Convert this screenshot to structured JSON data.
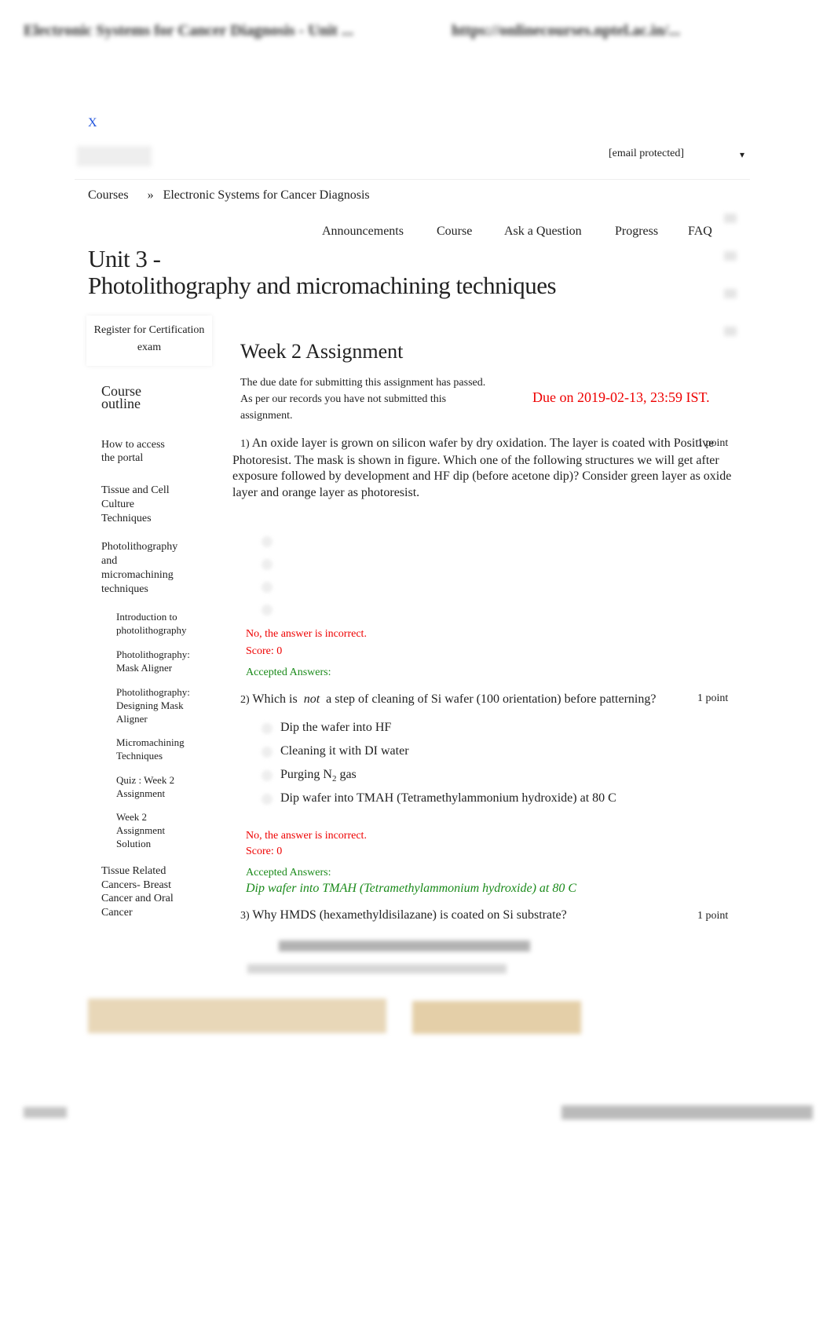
{
  "browser": {
    "title": "Electronic Systems for Cancer Diagnosis - Unit ...",
    "url": "https://onlinecourses.nptel.ac.in/..."
  },
  "close_label": "X",
  "user": {
    "email": "[email protected]",
    "dropdown": "▾"
  },
  "breadcrumb": {
    "root": "Courses",
    "sep": "»",
    "course": "Electronic Systems for Cancer Diagnosis"
  },
  "nav": [
    "Announcements",
    "Course",
    "Ask a Question",
    "Progress",
    "FAQ"
  ],
  "unit_title": {
    "line1": "Unit 3 -",
    "line2": "Photolithography and micromachining techniques"
  },
  "sidebar": {
    "register": "Register for Certification exam",
    "outline": "Course outline",
    "items": [
      "How to access the portal",
      "Tissue and Cell Culture Techniques",
      "Photolithography and micromachining techniques"
    ],
    "subitems": [
      "Introduction to photolithography",
      "Photolithography: Mask Aligner",
      "Photolithography: Designing Mask Aligner",
      "Micromachining Techniques",
      "Quiz : Week 2 Assignment",
      "Week 2 Assignment Solution"
    ],
    "last": "Tissue Related Cancers- Breast Cancer and Oral Cancer"
  },
  "assignment": {
    "title": "Week 2 Assignment",
    "notice1": "The due date for submitting this assignment has passed.",
    "notice2": "As per our records you have not submitted this assignment.",
    "due": "Due on 2019-02-13, 23:59 IST."
  },
  "questions": [
    {
      "num": "1)",
      "text": "An oxide layer is grown on silicon wafer by dry oxidation. The layer is coated with Positive Photoresist. The mask is shown in figure. Which one of the following structures we will get after exposure followed by development and HF dip (before acetone dip)? Consider green layer as oxide layer and orange layer as photoresist.",
      "points": "1 point",
      "feedback": "No, the answer is incorrect.",
      "score": "Score: 0",
      "accepted_label": "Accepted Answers:"
    },
    {
      "num": "2)",
      "text_pre": "Which is ",
      "text_em": "not",
      "text_post": " a step of cleaning of Si wafer (100 orientation) before patterning?",
      "points": "1 point",
      "options": [
        "Dip the wafer into HF",
        "Cleaning it with DI water",
        "Purging N",
        "Dip wafer into TMAH (Tetramethylammonium hydroxide) at 80 C"
      ],
      "option3_sub": "2",
      "option3_post": " gas",
      "feedback": "No, the answer is incorrect.",
      "score": "Score: 0",
      "accepted_label": "Accepted Answers:",
      "accepted": "Dip wafer into TMAH (Tetramethylammonium hydroxide) at 80 C"
    },
    {
      "num": "3)",
      "text": "Why HMDS (hexamethyldisilazane) is coated on Si substrate?",
      "points": "1 point"
    }
  ],
  "colors": {
    "link": "#2255dd",
    "error": "#ee0000",
    "success": "#1a8a1a",
    "blurred_button": "#e8d7b8"
  }
}
